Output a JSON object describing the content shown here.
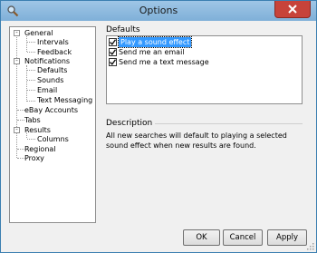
{
  "window": {
    "title": "Options"
  },
  "sidebar": {
    "items": [
      {
        "label": "General",
        "expander": "-"
      },
      {
        "label": "Intervals"
      },
      {
        "label": "Feedback"
      },
      {
        "label": "Notifications",
        "expander": "-"
      },
      {
        "label": "Defaults"
      },
      {
        "label": "Sounds"
      },
      {
        "label": "Email"
      },
      {
        "label": "Text Messaging"
      },
      {
        "label": "eBay Accounts"
      },
      {
        "label": "Tabs"
      },
      {
        "label": "Results",
        "expander": "-"
      },
      {
        "label": "Columns"
      },
      {
        "label": "Regional"
      },
      {
        "label": "Proxy"
      }
    ]
  },
  "defaults": {
    "heading": "Defaults",
    "options": [
      {
        "label": "Play a sound effect",
        "checked": true,
        "selected": true
      },
      {
        "label": "Send me an email",
        "checked": true
      },
      {
        "label": "Send me a text message",
        "checked": true
      }
    ]
  },
  "description": {
    "heading": "Description",
    "text": "All new searches will default to playing a selected sound effect when new results are found."
  },
  "buttons": {
    "ok": "OK",
    "cancel": "Cancel",
    "apply": "Apply"
  },
  "icons": {
    "app": "magnifier-icon",
    "close": "close-icon",
    "check": "checkmark-icon",
    "grip": "resize-grip-icon"
  },
  "colors": {
    "selection": "#3399ff",
    "close_button": "#c7433a",
    "titlebar": "#8fbbe0"
  }
}
